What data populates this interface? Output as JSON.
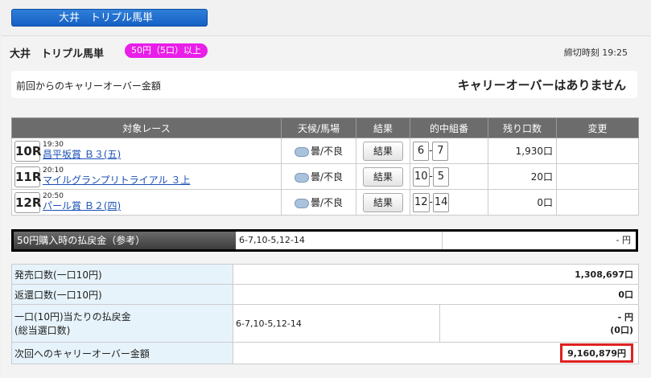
{
  "tab_title": "大井　トリプル馬単",
  "header": {
    "race": "大井　トリプル馬単",
    "badge": "50円（5口）以上",
    "deadline": "締切時刻 19:25"
  },
  "carryover": {
    "label": "前回からのキャリーオーバー金額",
    "value": "キャリーオーバーはありません"
  },
  "races_table": {
    "headers": [
      "対象レース",
      "天候/馬場",
      "結果",
      "的中組番",
      "残り口数",
      "変更"
    ],
    "rows": [
      {
        "no": "10R",
        "time": "19:30",
        "name": "昌平坂賞 Ｂ３(五)",
        "weather": "曇/不良",
        "result": "結果",
        "n1": "6",
        "n2": "7",
        "remain": "1,930口"
      },
      {
        "no": "11R",
        "time": "20:10",
        "name": "マイルグランプリトライアル ３上",
        "weather": "曇/不良",
        "result": "結果",
        "n1": "10",
        "n2": "5",
        "remain": "20口"
      },
      {
        "no": "12R",
        "time": "20:50",
        "name": "パール賞 Ｂ２(四)",
        "weather": "曇/不良",
        "result": "結果",
        "n1": "12",
        "n2": "14",
        "remain": "0口"
      }
    ]
  },
  "reference": {
    "label": "50円購入時の払戻金（参考）",
    "combo": "6-7,10-5,12-14",
    "payout": "- 円"
  },
  "sales": {
    "sold_label": "発売口数(一口10円)",
    "sold_value": "1,308,697口",
    "refund_label": "返還口数(一口10円)",
    "refund_value": "0口",
    "payout_label1": "一口(10円)当たりの払戻金",
    "payout_label2": "(総当選口数)",
    "payout_combo": "6-7,10-5,12-14",
    "payout_value": "- 円",
    "payout_count": "(0口)",
    "next_label": "次回へのキャリーオーバー金額",
    "next_value": "9,160,879円"
  }
}
